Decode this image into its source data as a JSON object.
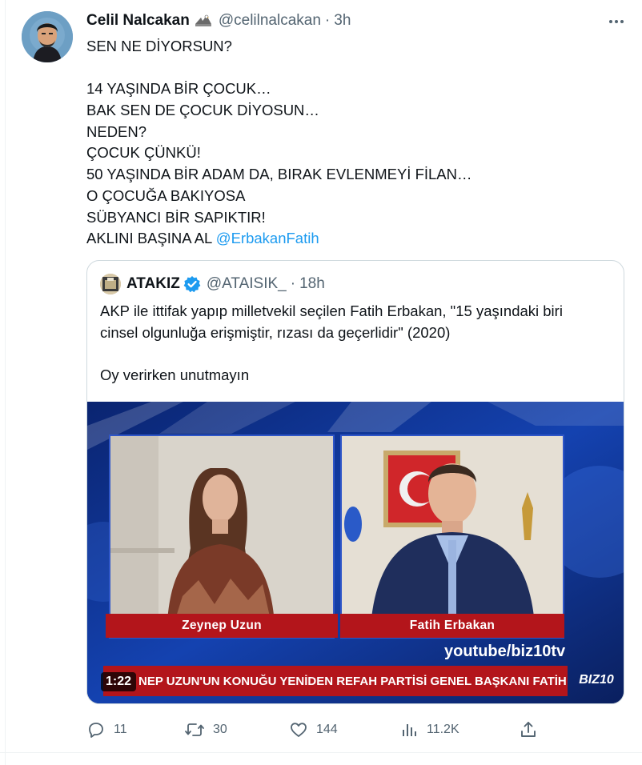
{
  "tweet": {
    "author_name": "Celil Nalcakan",
    "author_badge_icon": "eagle-emoji",
    "author_handle": "@celilnalcakan",
    "separator": "·",
    "time": "3h",
    "more_icon": "ellipsis-icon",
    "lines": [
      "SEN NE DİYORSUN?",
      "",
      "14 YAŞINDA BİR ÇOCUK…",
      "BAK SEN DE ÇOCUK DİYOSUN…",
      "NEDEN?",
      "ÇOCUK ÇÜNKÜ!",
      "50 YAŞINDA BİR ADAM DA, BIRAK EVLENMEYİ FİLAN…",
      "O ÇOCUĞA BAKIYOSA",
      "SÜBYANCI BİR SAPIKTIR!"
    ],
    "last_line_prefix": "AKLINI BAŞINA AL ",
    "mention": "@ErbakanFatih"
  },
  "quote": {
    "author_name": "ATAKIZ",
    "verified_icon": "verified-badge-icon",
    "author_handle": "@ATAISIK_",
    "separator": "·",
    "time": "18h",
    "lines": [
      "AKP ile ittifak yapıp milletvekil seçilen Fatih Erbakan, \"15 yaşındaki biri",
      "cinsel olgunluğa erişmiştir, rızası da geçerlidir\" (2020)",
      "",
      "Oy verirken unutmayın"
    ],
    "video": {
      "left_name": "Zeynep Uzun",
      "right_name": "Fatih Erbakan",
      "channel": "youtube/biz10tv",
      "ticker": "NEP UZUN'UN KONUĞU YENİDEN REFAH PARTİSİ GENEL BAŞKANI FATİH ERBAKAN",
      "logo": "BIZ10",
      "duration": "1:22"
    }
  },
  "actions": {
    "reply_count": "11",
    "retweet_count": "30",
    "like_count": "144",
    "views_count": "11.2K"
  },
  "colors": {
    "text": "#0f1419",
    "secondary": "#536471",
    "link": "#1d9bf0",
    "border": "#cfd9de",
    "ticker_red": "#b3151b",
    "video_blue": "#0d2a7a"
  }
}
